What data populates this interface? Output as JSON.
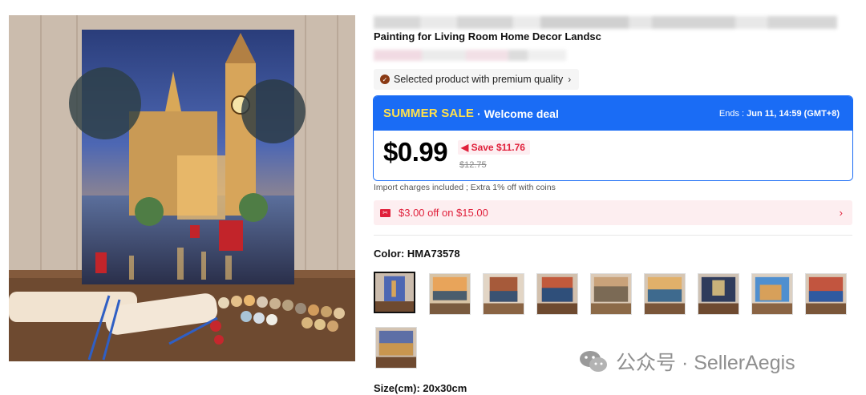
{
  "product": {
    "title": "Painting for Living Room Home Decor Landsc",
    "quality_badge": "Selected product with premium quality",
    "quality_chevron": "›"
  },
  "deal": {
    "sale_label": "SUMMER SALE",
    "separator": "·",
    "welcome_label": "Welcome deal",
    "ends_label": "Ends :",
    "ends_value": "Jun 11, 14:59 (GMT+8)",
    "price": "$0.99",
    "save_text": "Save $11.76",
    "original_price": "$12.75",
    "colors": {
      "accent": "#1a6cf5",
      "sale_text": "#ffe14d",
      "discount_red": "#e0203b"
    }
  },
  "import_note": "Import charges included ; Extra 1% off with coins",
  "coupon": {
    "text": "$3.00 off on $15.00",
    "chevron": "›"
  },
  "color_option": {
    "label": "Color: HMA73578",
    "selected_index": 0,
    "thumb_count": 10
  },
  "size_option": {
    "label": "Size(cm): 20x30cm"
  },
  "watermark": {
    "text": "公众号 · SellerAegis",
    "icon": "wechat-icon"
  }
}
